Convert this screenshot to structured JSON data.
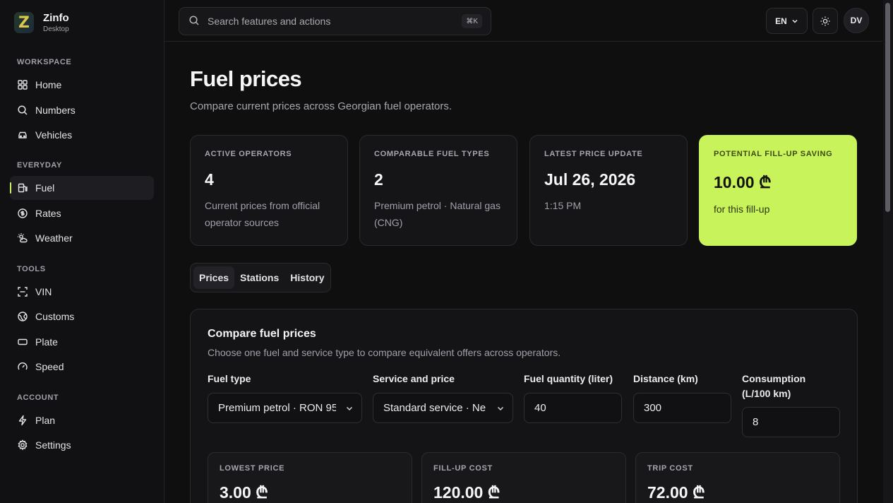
{
  "brand": {
    "name": "Zinfo",
    "subtitle": "Desktop",
    "logo_letter": "Z"
  },
  "sidebar": {
    "sections": [
      {
        "label": "WORKSPACE"
      },
      {
        "label": "EVERYDAY"
      },
      {
        "label": "TOOLS"
      },
      {
        "label": "ACCOUNT"
      }
    ],
    "items": [
      {
        "label": "Home",
        "icon": "grid-icon"
      },
      {
        "label": "Numbers",
        "icon": "search-icon"
      },
      {
        "label": "Vehicles",
        "icon": "car-icon"
      },
      {
        "label": "Fuel",
        "icon": "fuel-pump-icon",
        "active": true
      },
      {
        "label": "Rates",
        "icon": "currency-icon"
      },
      {
        "label": "Weather",
        "icon": "sun-cloud-icon"
      },
      {
        "label": "VIN",
        "icon": "scan-icon"
      },
      {
        "label": "Customs",
        "icon": "globe-icon"
      },
      {
        "label": "Plate",
        "icon": "plate-icon"
      },
      {
        "label": "Speed",
        "icon": "gauge-icon"
      },
      {
        "label": "Plan",
        "icon": "bolt-icon"
      },
      {
        "label": "Settings",
        "icon": "gear-icon"
      }
    ]
  },
  "header": {
    "search_placeholder": "Search features and actions",
    "search_shortcut": "⌘K",
    "language": "EN",
    "avatar_initials": "DV"
  },
  "page": {
    "title": "Fuel prices",
    "subtitle": "Compare current prices across Georgian fuel operators."
  },
  "stats": [
    {
      "label": "ACTIVE OPERATORS",
      "value": "4",
      "desc": "Current prices from official operator sources"
    },
    {
      "label": "COMPARABLE FUEL TYPES",
      "value": "2",
      "desc": "Premium petrol · Natural gas (CNG)"
    },
    {
      "label": "LATEST PRICE UPDATE",
      "value": "Jul 26, 2026",
      "desc": "1:15 PM"
    },
    {
      "label": "POTENTIAL FILL-UP SAVING",
      "value": "10.00 ₾",
      "desc": "for this fill-up"
    }
  ],
  "tabs": [
    {
      "label": "Prices",
      "active": true
    },
    {
      "label": "Stations"
    },
    {
      "label": "History"
    }
  ],
  "compare": {
    "title": "Compare fuel prices",
    "subtitle": "Choose one fuel and service type to compare equivalent offers across operators.",
    "fields": {
      "fuel_type": {
        "label": "Fuel type",
        "value": "Premium petrol · RON 95"
      },
      "service": {
        "label": "Service and price",
        "value": "Standard service · Ne"
      },
      "quantity": {
        "label": "Fuel quantity (liter)",
        "value": "40"
      },
      "distance": {
        "label": "Distance (km)",
        "value": "300"
      },
      "consumption": {
        "label": "Consumption (L/100 km)",
        "value": "8"
      }
    },
    "results": [
      {
        "label": "LOWEST PRICE",
        "value": "3.00 ₾"
      },
      {
        "label": "FILL-UP COST",
        "value": "120.00 ₾"
      },
      {
        "label": "TRIP COST",
        "value": "72.00 ₾"
      }
    ]
  },
  "colors": {
    "accent": "#c8f35a",
    "background": "#0f0f10",
    "card": "#151518"
  }
}
